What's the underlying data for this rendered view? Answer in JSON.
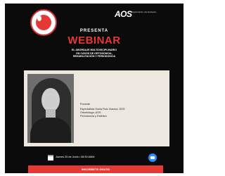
{
  "header": {
    "logo_text": "AOS",
    "logo_subtitle": "organización odontológica",
    "presents": "PRESENTA",
    "title": "WEBINAR",
    "subtitle_lines": [
      "EL ABORDAJE MULTIDISCIPLINARIO",
      "EN CASOS DE ORTODONCIA,",
      "REHABILITACIÓN Y PERIODONCIA"
    ]
  },
  "speaker": {
    "label": "Ponente",
    "name_lines": [
      "Especialista Sonia Ruiz Zuazua, DDS",
      "Odontóloga, AOS",
      "Periodoncia y Estética"
    ]
  },
  "event": {
    "datetime": "Jueves 25 de Junio • 08:30 AMM"
  },
  "cta": {
    "label": "INSCRÍBETE GRATIS"
  },
  "colors": {
    "background": "#0b0b0b",
    "accent": "#e53935",
    "panel": "#ece8df",
    "zoom": "#2d8cff"
  },
  "icons": [
    "calendar-icon",
    "zoom-icon",
    "seal-logo"
  ]
}
